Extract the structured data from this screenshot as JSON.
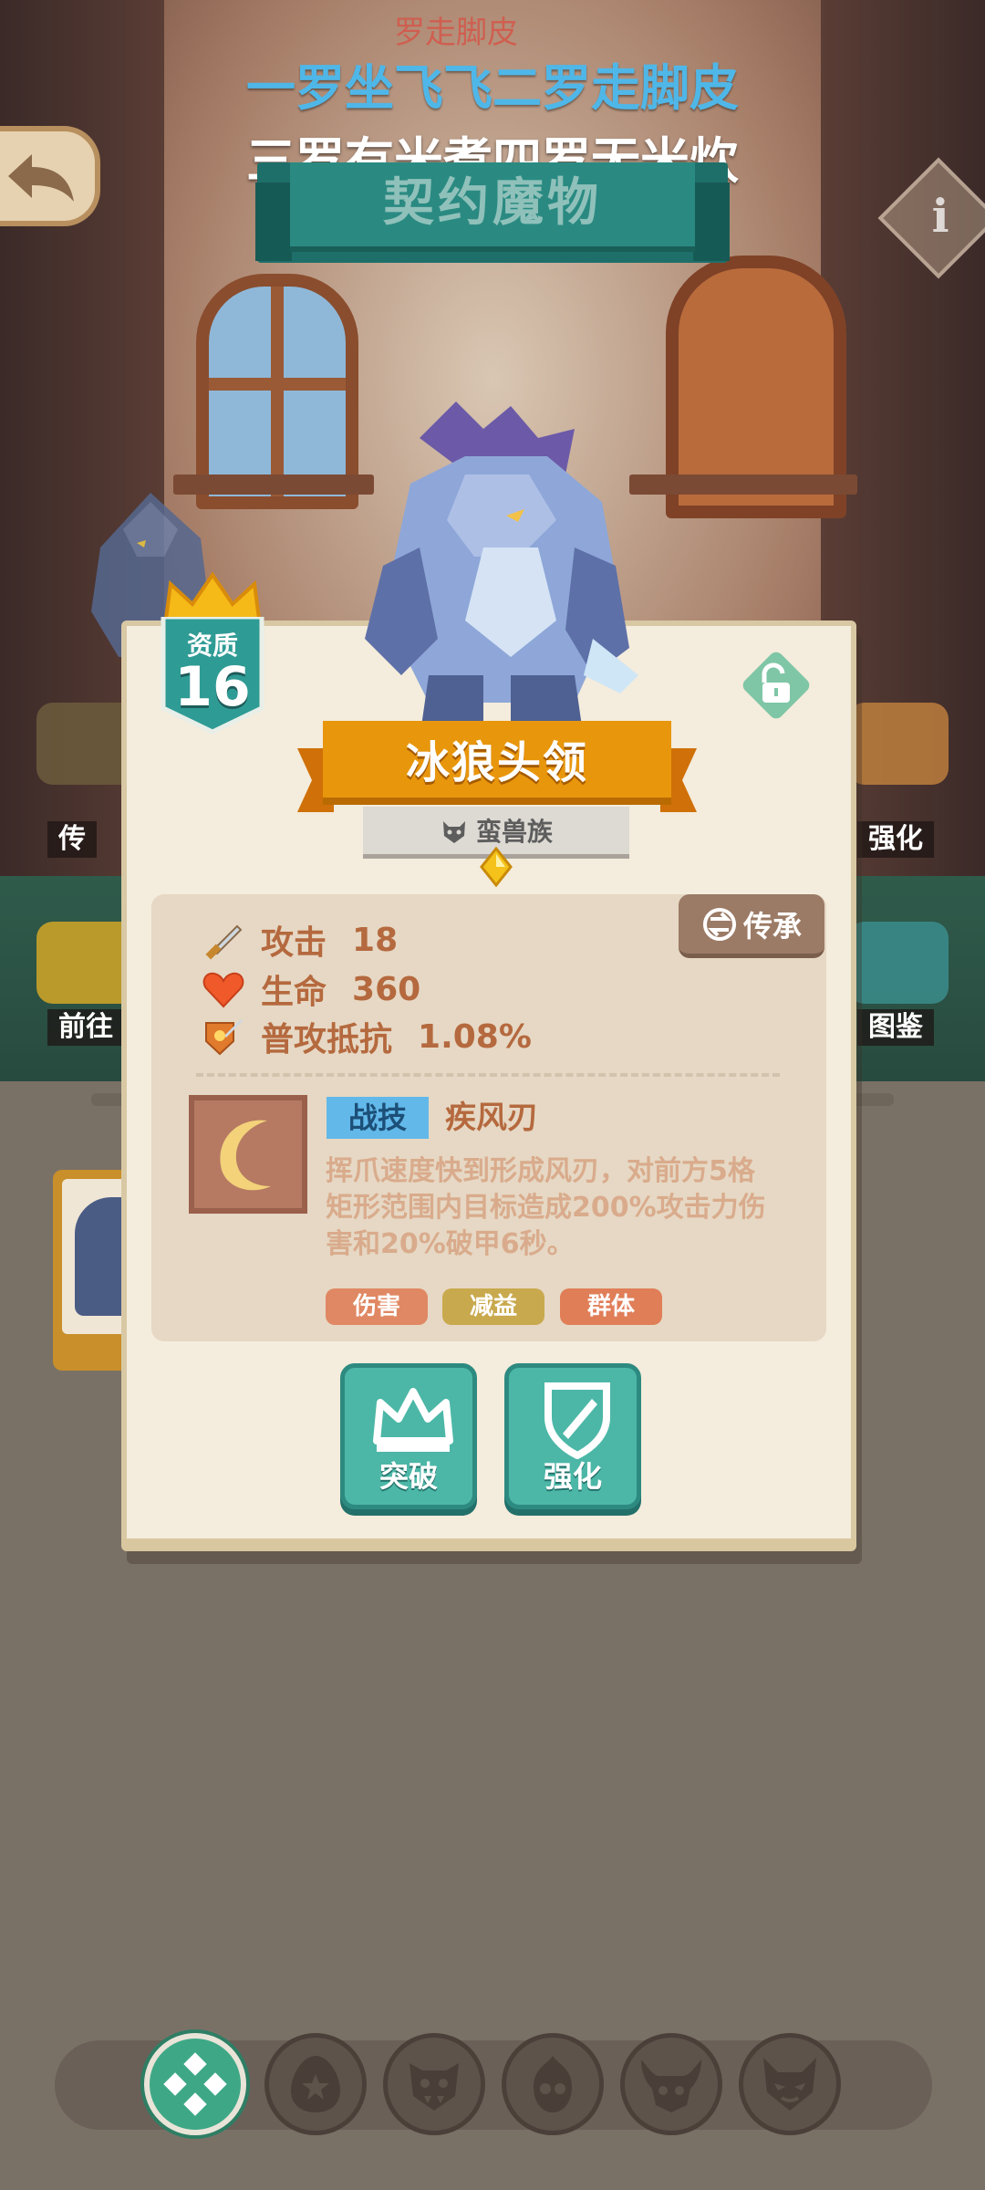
{
  "captions": {
    "faded": "罗走脚皮",
    "line1": "一罗坐飞飞二罗走脚皮",
    "line2": "三罗有米煮四罗无米炊"
  },
  "header": {
    "title": "契约魔物",
    "back_icon": "back-arrow-icon",
    "info_label": "i"
  },
  "side_menu": {
    "left_top": "传",
    "left_bottom": "前往",
    "right_top": "强化",
    "right_bottom": "图鉴"
  },
  "monster": {
    "grade_label": "资质",
    "grade_value": "16",
    "name": "冰狼头领",
    "race": "蛮兽族",
    "inherit_label": "传承",
    "stats": [
      {
        "label": "攻击",
        "value": "18",
        "icon": "sword-icon"
      },
      {
        "label": "生命",
        "value": "360",
        "icon": "heart-icon"
      },
      {
        "label": "普攻抵抗",
        "value": "1.08%",
        "icon": "shield-sword-icon"
      }
    ],
    "skill": {
      "type": "战技",
      "name": "疾风刃",
      "description": "挥爪速度快到形成风刃，对前方5格矩形范围内目标造成200%攻击力伤害和20%破甲6秒。",
      "tags": [
        "伤害",
        "减益",
        "群体"
      ]
    },
    "actions": {
      "breakthrough": "突破",
      "enhance": "强化"
    }
  },
  "colors": {
    "teal": "#4cb7a7",
    "orange_ribbon": "#e8960c",
    "stat_text": "#b5693e",
    "skill_type_bg": "#62b8e9",
    "tag_damage": "#e08863",
    "tag_debuff": "#c9a94d",
    "tag_group": "#e07e58"
  },
  "bottom_nav": [
    {
      "icon": "four-diamond-icon",
      "active": true
    },
    {
      "icon": "star-egg-icon",
      "active": false
    },
    {
      "icon": "orc-face-icon",
      "active": false
    },
    {
      "icon": "flame-skull-icon",
      "active": false
    },
    {
      "icon": "horned-skull-icon",
      "active": false
    },
    {
      "icon": "demon-face-icon",
      "active": false
    }
  ]
}
